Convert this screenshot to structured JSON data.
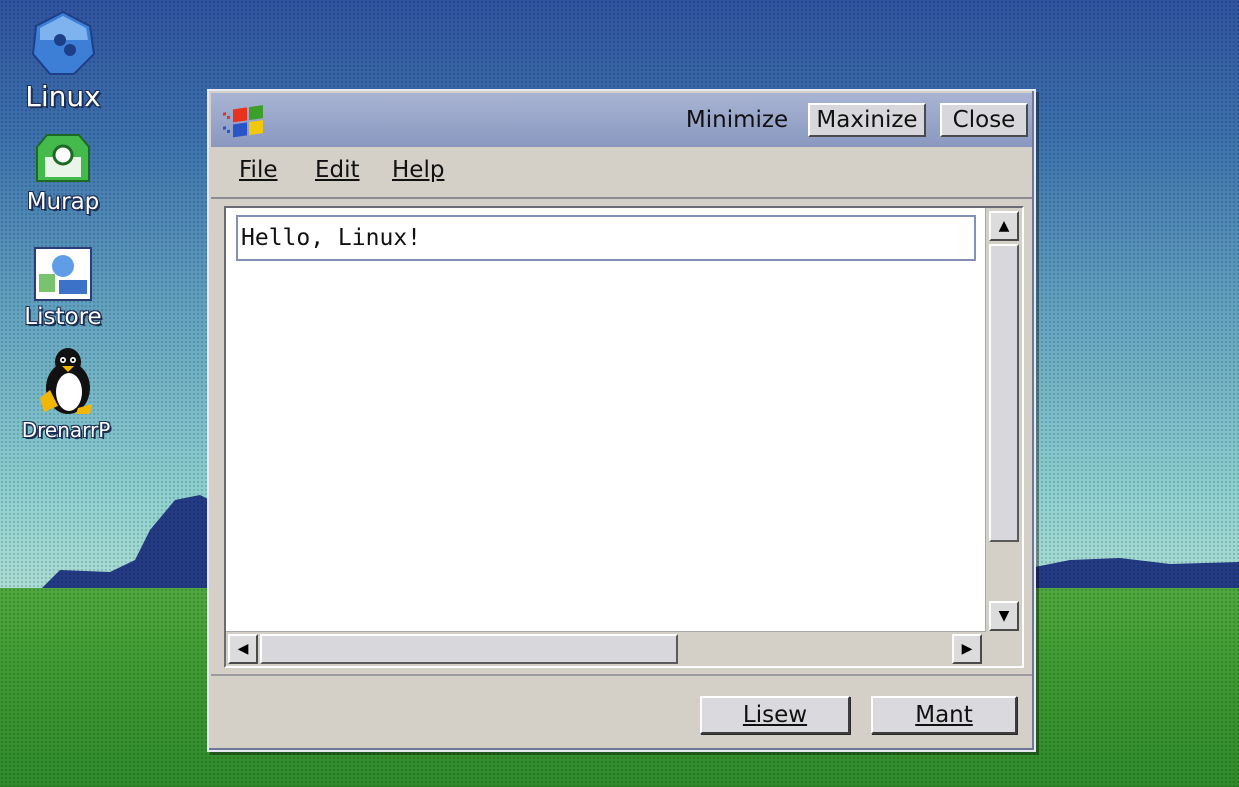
{
  "desktop": {
    "icons": [
      {
        "label": "Linux"
      },
      {
        "label": "Murap"
      },
      {
        "label": "Listore"
      },
      {
        "label": "DrenarrP"
      }
    ]
  },
  "window": {
    "title_buttons": {
      "minimize": "Minimize",
      "maximize": "Maxinize",
      "close": "Close"
    },
    "menu": {
      "file": "File",
      "edit": "Edit",
      "help": "Help"
    },
    "editor": {
      "text": "Hello, Linux!"
    },
    "buttons": {
      "primary": "Lisew",
      "secondary": "Mant"
    }
  },
  "colors": {
    "titlebar": "#8a98c0",
    "window_bg": "#d4d0c8",
    "sky_top": "#2f53a0",
    "grass": "#3f9a33"
  }
}
